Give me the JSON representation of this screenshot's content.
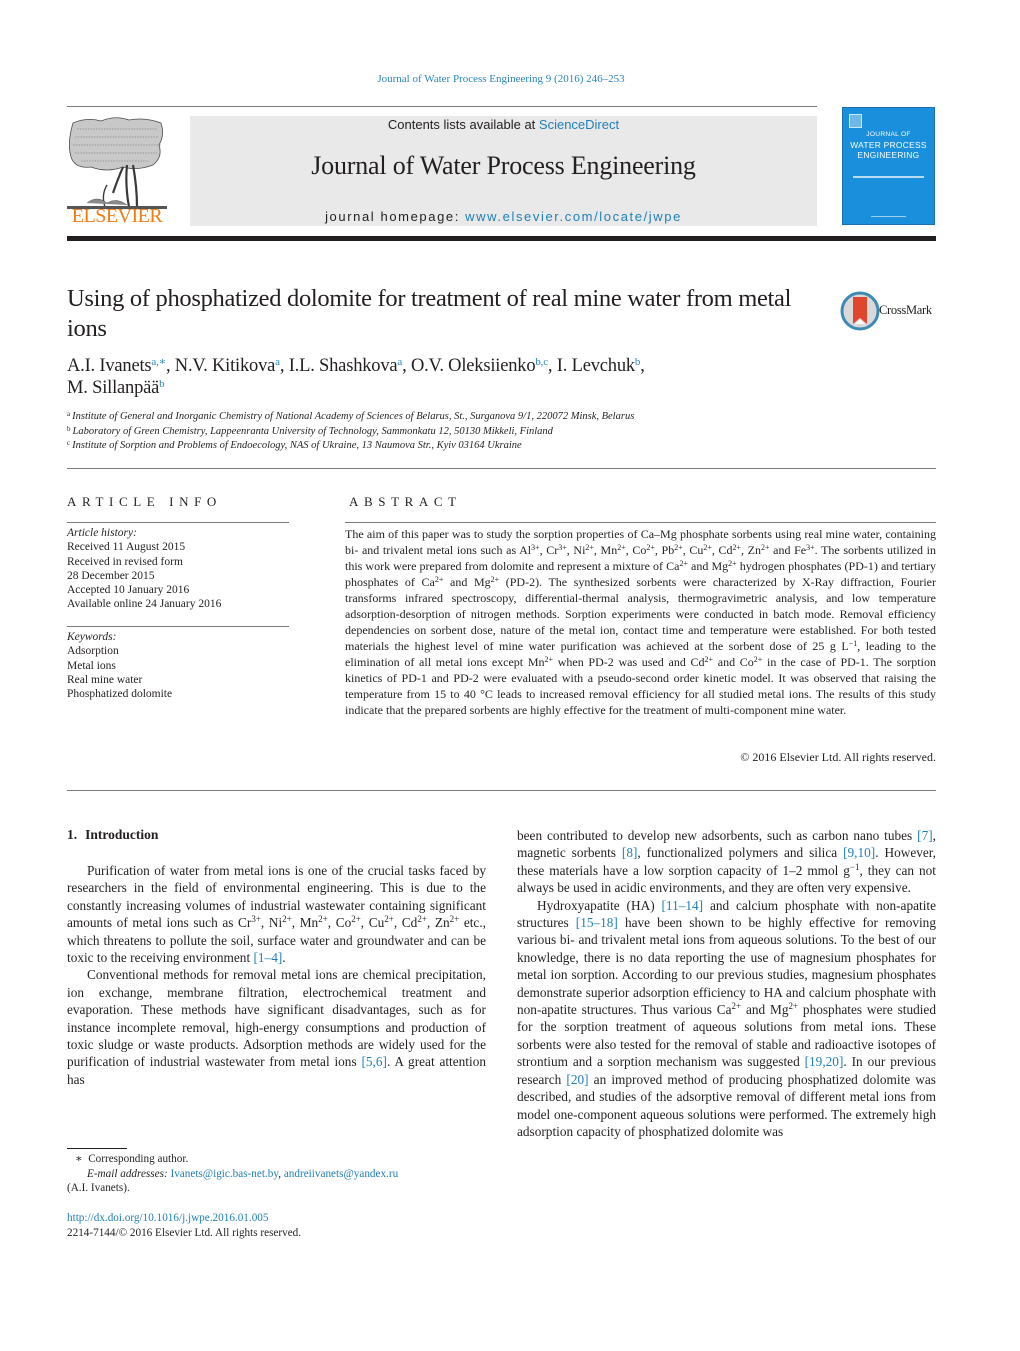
{
  "running_head": "Journal of Water Process Engineering 9 (2016) 246–253",
  "masthead": {
    "publisher_logo_label": "ELSEVIER",
    "contents_prefix": "Contents lists available at ",
    "contents_link": "ScienceDirect",
    "journal_name": "Journal of Water Process Engineering",
    "homepage_prefix": "journal homepage: ",
    "homepage_link": "www.elsevier.com/locate/jwpe",
    "cover": {
      "title_line1": "JOURNAL OF",
      "title_line2": "WATER PROCESS",
      "title_line3": "ENGINEERING",
      "color": "#1a8fdc"
    }
  },
  "article": {
    "title": "Using of phosphatized dolomite for treatment of real mine water from metal ions",
    "crossmark_label": "CrossMark",
    "authors": [
      {
        "name": "A.I. Ivanets",
        "sup": "a,∗",
        "sep": ", "
      },
      {
        "name": "N.V. Kitikova",
        "sup": "a",
        "sep": ", "
      },
      {
        "name": "I.L. Shashkova",
        "sup": "a",
        "sep": ", "
      },
      {
        "name": "O.V. Oleksiienko",
        "sup": "b,c",
        "sep": ", "
      },
      {
        "name": "I. Levchuk",
        "sup": "b",
        "sep": ","
      },
      {
        "name": "M. Sillanpää",
        "sup": "b",
        "sep": ""
      }
    ],
    "affiliations": [
      {
        "key": "a",
        "text": "Institute of General and Inorganic Chemistry of National Academy of Sciences of Belarus, St., Surganova 9/1, 220072 Minsk, Belarus"
      },
      {
        "key": "b",
        "text": "Laboratory of Green Chemistry, Lappeenranta University of Technology, Sammonkatu 12, 50130 Mikkeli, Finland"
      },
      {
        "key": "c",
        "text": "Institute of Sorption and Problems of Endoecology, NAS of Ukraine, 13 Naumova Str., Kyiv 03164 Ukraine"
      }
    ]
  },
  "article_info": {
    "heading": "ARTICLE INFO",
    "history_label": "Article history:",
    "history": [
      "Received 11 August 2015",
      "Received in revised form",
      "28 December 2015",
      "Accepted 10 January 2016",
      "Available online 24 January 2016"
    ],
    "keywords_label": "Keywords:",
    "keywords": [
      "Adsorption",
      "Metal ions",
      "Real mine water",
      "Phosphatized dolomite"
    ]
  },
  "abstract": {
    "heading": "ABSTRACT",
    "segments": [
      {
        "t": "The aim of this paper was to study the sorption properties of Ca–Mg phosphate sorbents using real mine water, containing bi- and trivalent metal ions such as Al"
      },
      {
        "sup": "3+"
      },
      {
        "t": ", Cr"
      },
      {
        "sup": "3+"
      },
      {
        "t": ", Ni"
      },
      {
        "sup": "2+"
      },
      {
        "t": ", Mn"
      },
      {
        "sup": "2+"
      },
      {
        "t": ", Co"
      },
      {
        "sup": "2+"
      },
      {
        "t": ", Pb"
      },
      {
        "sup": "2+"
      },
      {
        "t": ", Cu"
      },
      {
        "sup": "2+"
      },
      {
        "t": ", Cd"
      },
      {
        "sup": "2+"
      },
      {
        "t": ", Zn"
      },
      {
        "sup": "2+"
      },
      {
        "t": " and Fe"
      },
      {
        "sup": "3+"
      },
      {
        "t": ". The sorbents utilized in this work were prepared from dolomite and represent a mixture of Ca"
      },
      {
        "sup": "2+"
      },
      {
        "t": " and Mg"
      },
      {
        "sup": "2+"
      },
      {
        "t": " hydrogen phosphates (PD-1) and tertiary phosphates of Ca"
      },
      {
        "sup": "2+"
      },
      {
        "t": " and Mg"
      },
      {
        "sup": "2+"
      },
      {
        "t": " (PD-2). The synthesized sorbents were characterized by X-Ray diffraction, Fourier transforms infrared spectroscopy, differential-thermal analysis, thermogravimetric analysis, and low temperature adsorption-desorption of nitrogen methods. Sorption experiments were conducted in batch mode. Removal efficiency dependencies on sorbent dose, nature of the metal ion, contact time and temperature were established. For both tested materials the highest level of mine water purification was achieved at the sorbent dose of 25 g L"
      },
      {
        "sup": "−1"
      },
      {
        "t": ", leading to the elimination of all metal ions except Mn"
      },
      {
        "sup": "2+"
      },
      {
        "t": " when PD-2 was used and Cd"
      },
      {
        "sup": "2+"
      },
      {
        "t": " and Co"
      },
      {
        "sup": "2+"
      },
      {
        "t": " in the case of PD-1. The sorption kinetics of PD-1 and PD-2 were evaluated with a pseudo-second order kinetic model. It was observed that raising the temperature from 15 to 40 °C leads to increased removal efficiency for all studied metal ions. The results of this study indicate that the prepared sorbents are highly effective for the treatment of multi-component mine water."
      }
    ],
    "copyright": "© 2016 Elsevier Ltd. All rights reserved."
  },
  "body": {
    "intro_number": "1.",
    "intro_title": "Introduction",
    "left_paragraphs": [
      [
        {
          "t": "Purification of water from metal ions is one of the crucial tasks faced by researchers in the field of environmental engineering. This is due to the constantly increasing volumes of industrial wastewater containing significant amounts of metal ions such as Cr"
        },
        {
          "sup": "3+"
        },
        {
          "t": ", Ni"
        },
        {
          "sup": "2+"
        },
        {
          "t": ", Mn"
        },
        {
          "sup": "2+"
        },
        {
          "t": ", Co"
        },
        {
          "sup": "2+"
        },
        {
          "t": ", Cu"
        },
        {
          "sup": "2+"
        },
        {
          "t": ", Cd"
        },
        {
          "sup": "2+"
        },
        {
          "t": ", Zn"
        },
        {
          "sup": "2+"
        },
        {
          "t": " etc., which threatens to pollute the soil, surface water and groundwater and can be toxic to the receiving environment "
        },
        {
          "ref": "[1–4]"
        },
        {
          "t": "."
        }
      ],
      [
        {
          "t": "Conventional methods for removal metal ions are chemical precipitation, ion exchange, membrane filtration, electrochemical treatment and evaporation. These methods have significant disadvantages, such as for instance incomplete removal, high-energy consumptions and production of toxic sludge or waste products. Adsorption methods are widely used for the purification of industrial wastewater from metal ions "
        },
        {
          "ref": "[5,6]"
        },
        {
          "t": ". A great attention has"
        }
      ]
    ],
    "right_paragraphs": [
      [
        {
          "t": "been contributed to develop new adsorbents, such as carbon nano tubes "
        },
        {
          "ref": "[7]"
        },
        {
          "t": ", magnetic sorbents "
        },
        {
          "ref": "[8]"
        },
        {
          "t": ", functionalized polymers and silica "
        },
        {
          "ref": "[9,10]"
        },
        {
          "t": ". However, these materials have a low sorption capacity of 1–2 mmol g"
        },
        {
          "sup": "−1"
        },
        {
          "t": ", they can not always be used in acidic environments, and they are often very expensive."
        }
      ],
      [
        {
          "t": "Hydroxyapatite (HA) "
        },
        {
          "ref": "[11–14]"
        },
        {
          "t": " and calcium phosphate with non-apatite structures "
        },
        {
          "ref": "[15–18]"
        },
        {
          "t": " have been shown to be highly effective for removing various bi- and trivalent metal ions from aqueous solutions. To the best of our knowledge, there is no data reporting the use of magnesium phosphates for metal ion sorption. According to our previous studies, magnesium phosphates demonstrate superior adsorption efficiency to HA and calcium phosphate with non-apatite structures. Thus various Ca"
        },
        {
          "sup": "2+"
        },
        {
          "t": " and Mg"
        },
        {
          "sup": "2+"
        },
        {
          "t": " phosphates were studied for the sorption treatment of aqueous solutions from metal ions. These sorbents were also tested for the removal of stable and radioactive isotopes of strontium and a sorption mechanism was suggested "
        },
        {
          "ref": "[19,20]"
        },
        {
          "t": ". In our previous research "
        },
        {
          "ref": "[20]"
        },
        {
          "t": " an improved method of producing phosphatized dolomite was described, and studies of the adsorptive removal of different metal ions from model one-component aqueous solutions were performed. The extremely high adsorption capacity of phosphatized dolomite was"
        }
      ]
    ]
  },
  "footnotes": {
    "corresponding_mark": "∗",
    "corresponding_text": "Corresponding author.",
    "email_label": "E-mail addresses:",
    "emails": [
      "Ivanets@igic.bas-net.by",
      "andreiivanets@yandex.ru"
    ],
    "email_owner": "(A.I. Ivanets).",
    "doi": "http://dx.doi.org/10.1016/j.jwpe.2016.01.005",
    "issn_copyright": "2214-7144/© 2016 Elsevier Ltd. All rights reserved."
  },
  "colors": {
    "link": "#1f7fb8",
    "elsevier_orange": "#f07c12",
    "masthead_bg": "#e9e9e9",
    "text": "#231f20"
  }
}
